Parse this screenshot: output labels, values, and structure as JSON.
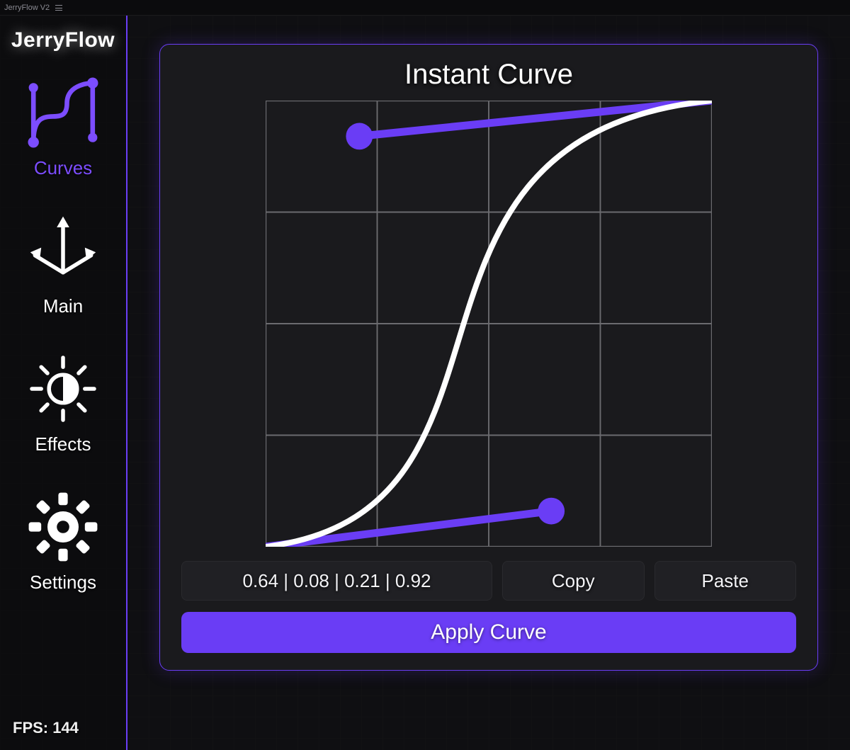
{
  "window": {
    "title": "JerryFlow V2"
  },
  "logo": "JerryFlow",
  "sidebar": {
    "items": [
      {
        "label": "Curves",
        "active": true
      },
      {
        "label": "Main",
        "active": false
      },
      {
        "label": "Effects",
        "active": false
      },
      {
        "label": "Settings",
        "active": false
      }
    ]
  },
  "fps": {
    "label": "FPS:",
    "value": "144"
  },
  "panel": {
    "title": "Instant Curve",
    "curve_values": "0.64 | 0.08 | 0.21 | 0.92",
    "copy_label": "Copy",
    "paste_label": "Paste",
    "apply_label": "Apply Curve",
    "bezier": {
      "p1x": 0.64,
      "p1y": 0.08,
      "p2x": 0.21,
      "p2y": 0.92
    }
  },
  "colors": {
    "accent": "#6a3df5",
    "curve": "#ffffff",
    "grid": "#6b6b6f",
    "bg_card": "#1a1a1d"
  }
}
